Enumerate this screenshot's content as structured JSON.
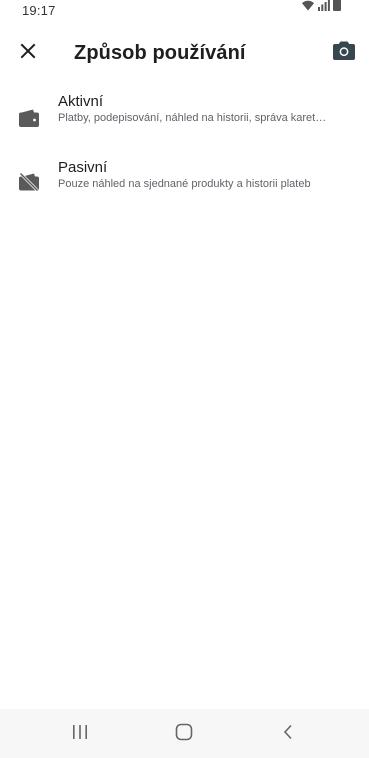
{
  "status_bar": {
    "time": "19:17",
    "icons": [
      "wifi-icon",
      "signal-icon",
      "battery-icon"
    ]
  },
  "app_bar": {
    "title": "Způsob používání",
    "close_icon": "close-icon",
    "camera_icon": "camera-icon"
  },
  "usage_modes": [
    {
      "title": "Aktivní",
      "description": "Platby, podepisování, náhled na historii, správa karet…",
      "icon": "wallet-icon"
    },
    {
      "title": "Pasivní",
      "description": "Pouze náhled na sjednané produkty a historii plateb",
      "icon": "wallet-off-icon"
    }
  ],
  "navigation_bar": {
    "buttons": [
      "recent-apps-icon",
      "home-icon",
      "back-icon"
    ]
  },
  "colors": {
    "text_primary": "#1f1f1f",
    "text_secondary": "#5f6368",
    "icon": "#5a5a5a",
    "camera_icon": "#37474f",
    "nav_background": "#f7f7f7",
    "background": "#ffffff"
  }
}
